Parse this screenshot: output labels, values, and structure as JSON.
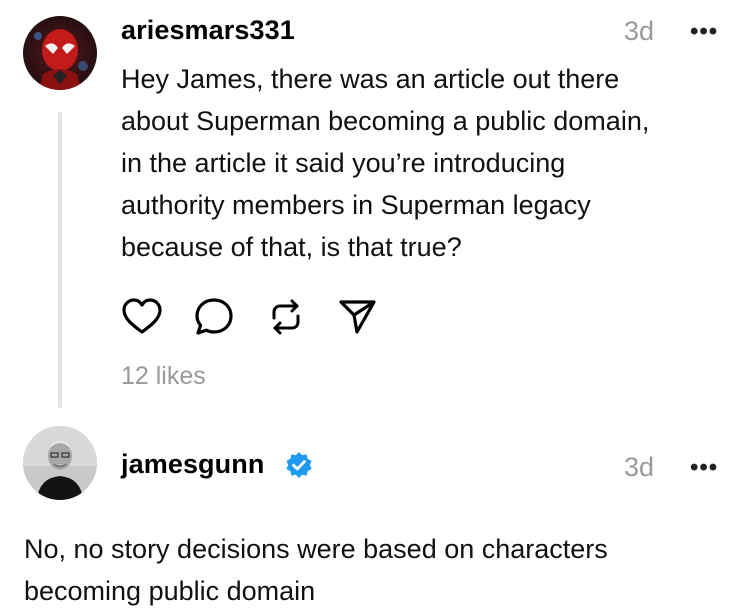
{
  "post": {
    "username": "ariesmars331",
    "time": "3d",
    "more": "•••",
    "lines": [
      "Hey James, there was an article out there",
      "about Superman becoming a public domain,",
      "in the article it said you’re introducing",
      "authority members in Superman legacy",
      "because of that, is that true?"
    ],
    "likes": "12 likes",
    "actions": [
      "heart-icon",
      "comment-icon",
      "repost-icon",
      "share-icon"
    ]
  },
  "reply": {
    "username": "jamesgunn",
    "verified": true,
    "time": "3d",
    "more": "•••",
    "lines": [
      "No, no story decisions were based on characters",
      "becoming public domain"
    ]
  },
  "colors": {
    "verified": "#1d9bf0",
    "thread_line": "#e4e4e4",
    "muted": "#9a9a9a"
  }
}
